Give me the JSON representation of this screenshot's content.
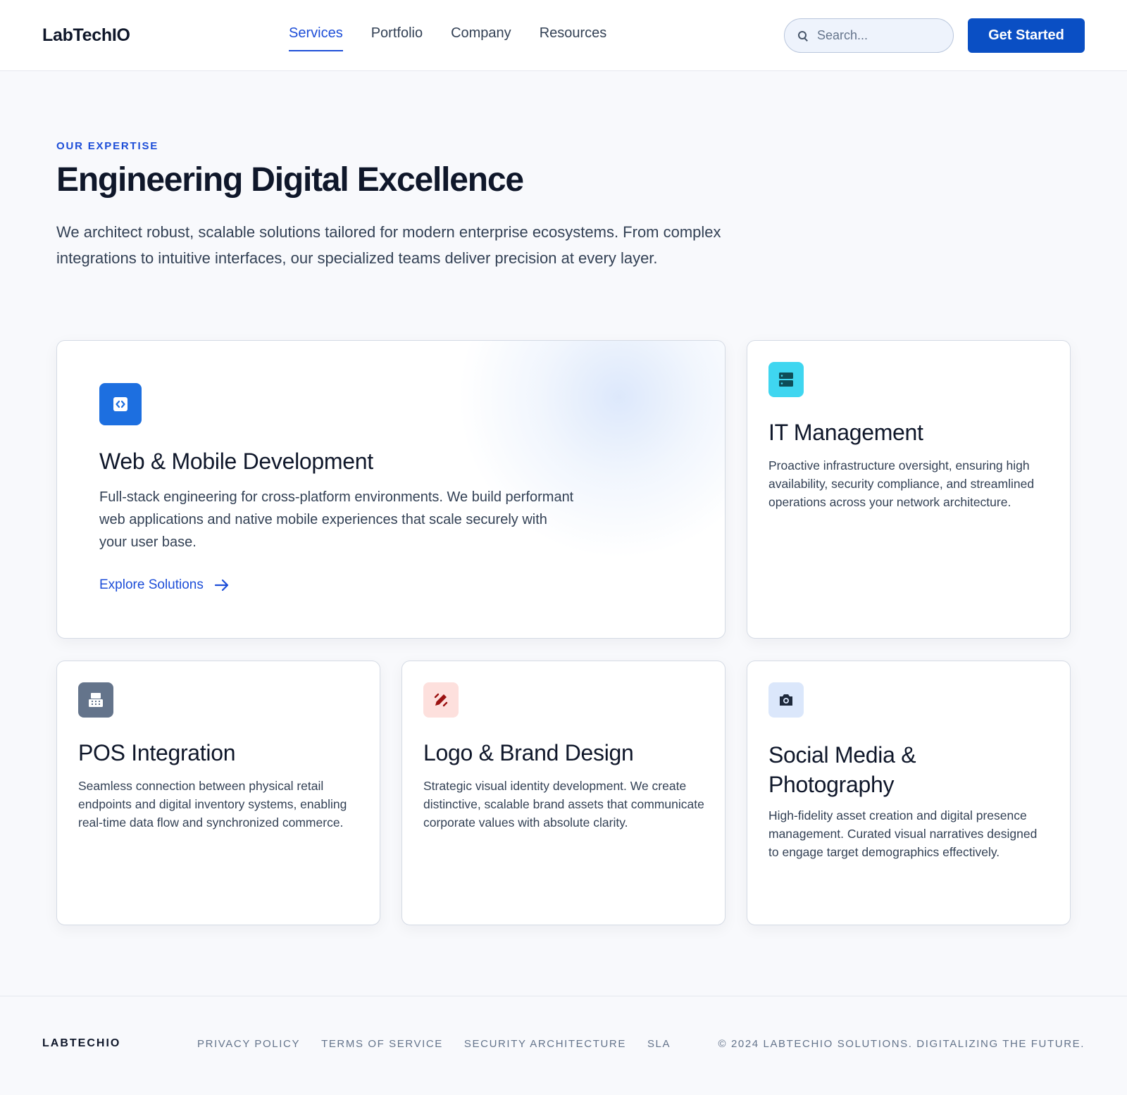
{
  "header": {
    "logo": "LabTechIO",
    "nav": [
      "Services",
      "Portfolio",
      "Company",
      "Resources"
    ],
    "active_nav": "Services",
    "search_placeholder": "Search...",
    "cta_label": "Get Started"
  },
  "hero": {
    "eyebrow": "OUR EXPERTISE",
    "title": "Engineering Digital Excellence",
    "intro": "We architect robust, scalable solutions tailored for modern enterprise ecosystems. From complex integrations to intuitive interfaces, our specialized teams deliver precision at every layer."
  },
  "services": {
    "web": {
      "icon": "code-icon",
      "title": "Web & Mobile Development",
      "description": "Full-stack engineering for cross-platform environments. We build performant web applications and native mobile experiences that scale securely with your user base.",
      "link_label": "Explore Solutions"
    },
    "it": {
      "icon": "server-icon",
      "title": "IT Management",
      "description": "Proactive infrastructure oversight, ensuring high availability, security compliance, and streamlined operations across your network architecture."
    },
    "pos": {
      "icon": "cash-register-icon",
      "title": "POS Integration",
      "description": "Seamless connection between physical retail endpoints and digital inventory systems, enabling real-time data flow and synchronized commerce."
    },
    "brand": {
      "icon": "pen-icon",
      "title": "Logo & Brand Design",
      "description": "Strategic visual identity development. We create distinctive, scalable brand assets that communicate corporate values with absolute clarity."
    },
    "social": {
      "icon": "camera-icon",
      "title": "Social Media & Photography",
      "description": "High-fidelity asset creation and digital presence management. Curated visual narratives designed to engage target demographics effectively."
    }
  },
  "footer": {
    "logo": "LABTECHIO",
    "links": [
      "PRIVACY POLICY",
      "TERMS OF SERVICE",
      "SECURITY ARCHITECTURE",
      "SLA"
    ],
    "copyright": "© 2024 LABTECHIO SOLUTIONS. DIGITALIZING THE FUTURE."
  },
  "colors": {
    "accent": "#1d4ed8",
    "button": "#0a4fc4",
    "web_icon_bg": "#1d6fe0",
    "it_icon_bg": "#3fd6f0",
    "pos_icon_bg": "#64748b",
    "brand_icon_bg": "#fde0dd",
    "social_icon_bg": "#dbe7fb"
  }
}
